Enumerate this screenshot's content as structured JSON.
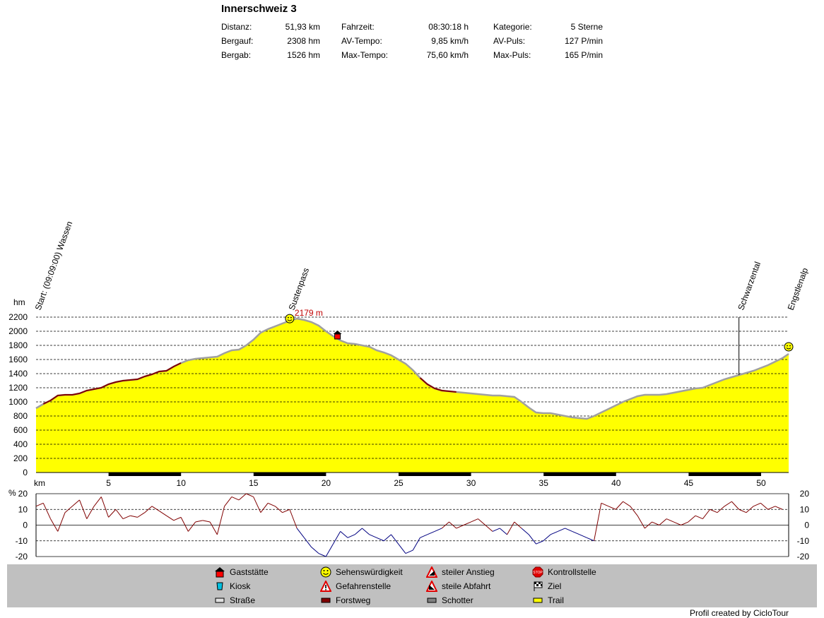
{
  "title": "Innerschweiz 3",
  "stats": [
    [
      {
        "label": "Distanz:",
        "value": "51,93 km"
      },
      {
        "label": "Fahrzeit:",
        "value": "08:30:18 h"
      },
      {
        "label": "Kategorie:",
        "value": "5 Sterne"
      }
    ],
    [
      {
        "label": "Bergauf:",
        "value": "2308 hm"
      },
      {
        "label": "AV-Tempo:",
        "value": "9,85 km/h"
      },
      {
        "label": "AV-Puls:",
        "value": "127 P/min"
      }
    ],
    [
      {
        "label": "Bergab:",
        "value": "1526 hm"
      },
      {
        "label": "Max-Tempo:",
        "value": "75,60 km/h"
      },
      {
        "label": "Max-Puls:",
        "value": "165 P/min"
      }
    ]
  ],
  "legend": [
    {
      "icon": "house-icon",
      "label": "Gaststätte"
    },
    {
      "icon": "smiley-icon",
      "label": "Sehenswürdigkeit"
    },
    {
      "icon": "climb-warning-icon",
      "label": "steiler Anstieg"
    },
    {
      "icon": "stop-icon",
      "label": "Kontrollstelle"
    },
    {
      "icon": "cup-icon",
      "label": "Kiosk"
    },
    {
      "icon": "danger-icon",
      "label": "Gefahrenstelle"
    },
    {
      "icon": "descent-warning-icon",
      "label": "steile Abfahrt"
    },
    {
      "icon": "checkered-flag-icon",
      "label": "Ziel"
    },
    {
      "icon": "road-swatch-icon",
      "label": "Straße",
      "color": "#e0e0e0"
    },
    {
      "icon": "forest-road-swatch-icon",
      "label": "Forstweg",
      "color": "#800000"
    },
    {
      "icon": "gravel-swatch-icon",
      "label": "Schotter",
      "color": "#808080"
    },
    {
      "icon": "trail-swatch-icon",
      "label": "Trail",
      "color": "#ffff00"
    }
  ],
  "credit": "Profil created by CicloTour",
  "chart_data": [
    {
      "type": "area",
      "ylabel": "hm",
      "xlabel": "km",
      "xlim": [
        0,
        51.93
      ],
      "ylim": [
        0,
        2200
      ],
      "x_ticks": [
        5,
        10,
        15,
        20,
        25,
        30,
        35,
        40,
        45,
        50
      ],
      "y_ticks": [
        0,
        200,
        400,
        600,
        800,
        1000,
        1200,
        1400,
        1600,
        1800,
        2000,
        2200
      ],
      "fill_color": "#ffff00",
      "grid": true,
      "x": [
        0,
        0.5,
        1,
        1.5,
        2,
        2.5,
        3,
        3.5,
        4,
        4.5,
        5,
        5.5,
        6,
        6.5,
        7,
        7.5,
        8,
        8.5,
        9,
        9.5,
        10,
        10.5,
        11,
        11.5,
        12,
        12.5,
        13,
        13.5,
        14,
        14.5,
        15,
        15.5,
        16,
        16.5,
        17,
        17.5,
        18,
        18.5,
        19,
        19.5,
        20,
        20.5,
        21,
        21.5,
        22,
        22.5,
        23,
        23.5,
        24,
        24.5,
        25,
        25.5,
        26,
        26.5,
        27,
        27.5,
        28,
        28.5,
        29,
        29.5,
        30,
        30.5,
        31,
        31.5,
        32,
        32.5,
        33,
        33.5,
        34,
        34.5,
        35,
        35.5,
        36,
        36.5,
        37,
        37.5,
        38,
        38.5,
        39,
        39.5,
        40,
        40.5,
        41,
        41.5,
        42,
        42.5,
        43,
        43.5,
        44,
        44.5,
        45,
        45.5,
        46,
        46.5,
        47,
        47.5,
        48,
        48.5,
        49,
        49.5,
        50,
        50.5,
        51,
        51.5,
        51.93
      ],
      "y": [
        910,
        970,
        1020,
        1090,
        1100,
        1100,
        1120,
        1160,
        1180,
        1200,
        1250,
        1280,
        1300,
        1310,
        1320,
        1360,
        1390,
        1430,
        1440,
        1500,
        1550,
        1590,
        1610,
        1620,
        1630,
        1640,
        1690,
        1730,
        1740,
        1800,
        1880,
        1980,
        2030,
        2070,
        2110,
        2150,
        2179,
        2160,
        2130,
        2080,
        2000,
        1930,
        1870,
        1830,
        1820,
        1800,
        1780,
        1730,
        1700,
        1660,
        1600,
        1540,
        1450,
        1340,
        1250,
        1190,
        1160,
        1150,
        1140,
        1130,
        1120,
        1110,
        1100,
        1090,
        1090,
        1080,
        1070,
        1000,
        920,
        850,
        840,
        840,
        820,
        800,
        780,
        770,
        760,
        800,
        850,
        900,
        950,
        1000,
        1040,
        1080,
        1100,
        1100,
        1100,
        1110,
        1130,
        1150,
        1170,
        1190,
        1200,
        1240,
        1280,
        1320,
        1350,
        1380,
        1410,
        1440,
        1480,
        1520,
        1570,
        1620,
        1680
      ],
      "labels": [
        {
          "x": 0,
          "text": "Start: (09:09:00) Wassen"
        },
        {
          "x": 17.5,
          "text": "Sustenpass"
        },
        {
          "x": 48.5,
          "text": "Schwarzental"
        },
        {
          "x": 51.93,
          "text": "Engstlenalp"
        }
      ],
      "annotations": [
        {
          "x": 17.5,
          "y": 2179,
          "text": "2179 m"
        }
      ],
      "markers": [
        {
          "x": 17.5,
          "y": 2179,
          "icon": "smiley-icon"
        },
        {
          "x": 20.8,
          "y": 1900,
          "icon": "house-icon"
        },
        {
          "x": 51.93,
          "y": 1780,
          "icon": "smiley-icon"
        }
      ],
      "dark_segments": [
        [
          0.3,
          10.0
        ],
        [
          26.5,
          29.4
        ]
      ]
    },
    {
      "type": "line",
      "ylabel": "%",
      "ylim": [
        -20,
        20
      ],
      "y_ticks": [
        -20,
        -10,
        0,
        10,
        20
      ],
      "series": [
        {
          "color": "#800000",
          "x": [
            0,
            0.5,
            1,
            1.5,
            2,
            2.5,
            3,
            3.5,
            4,
            4.5,
            5,
            5.5,
            6,
            6.5,
            7,
            7.5,
            8,
            8.5,
            9,
            9.5,
            10,
            10.5,
            11,
            11.5,
            12,
            12.5,
            13,
            13.5,
            14,
            14.5,
            15,
            15.5,
            16,
            16.5,
            17,
            17.5,
            18,
            18.5,
            19,
            19.5,
            20,
            20.5,
            21,
            21.5,
            22,
            22.5,
            23,
            23.5,
            24,
            24.5,
            25,
            25.5,
            26,
            26.5,
            27,
            27.5,
            28,
            28.5,
            29,
            29.5,
            30,
            30.5,
            31,
            31.5,
            32,
            32.5,
            33,
            33.5,
            34,
            34.5,
            35,
            35.5,
            36,
            36.5,
            37,
            37.5,
            38,
            38.5,
            39,
            39.5,
            40,
            40.5,
            41,
            41.5,
            42,
            42.5,
            43,
            43.5,
            44,
            44.5,
            45,
            45.5,
            46,
            46.5,
            47,
            47.5,
            48,
            48.5,
            49,
            49.5,
            50,
            50.5,
            51,
            51.5
          ],
          "y": [
            12,
            14,
            4,
            -4,
            8,
            12,
            16,
            4,
            12,
            18,
            5,
            10,
            4,
            6,
            5,
            8,
            12,
            9,
            6,
            3,
            5,
            -4,
            2,
            3,
            2,
            -6,
            12,
            18,
            16,
            20,
            18,
            8,
            14,
            12,
            8,
            10,
            -2,
            -8,
            -14,
            -18,
            -20,
            -12,
            -4,
            -8,
            -6,
            -2,
            -6,
            -8,
            -10,
            -6,
            -12,
            -18,
            -16,
            -8,
            -6,
            -4,
            -2,
            2,
            -2,
            0,
            2,
            4,
            0,
            -4,
            -2,
            -6,
            2,
            -2,
            -6,
            -12,
            -10,
            -6,
            -4,
            -2,
            -4,
            -6,
            -8,
            -10,
            14,
            12,
            10,
            15,
            12,
            6,
            -2,
            2,
            0,
            4,
            2,
            0,
            2,
            6,
            4,
            10,
            8,
            12,
            15,
            10,
            8,
            12,
            14,
            10,
            12,
            10
          ]
        }
      ]
    }
  ]
}
